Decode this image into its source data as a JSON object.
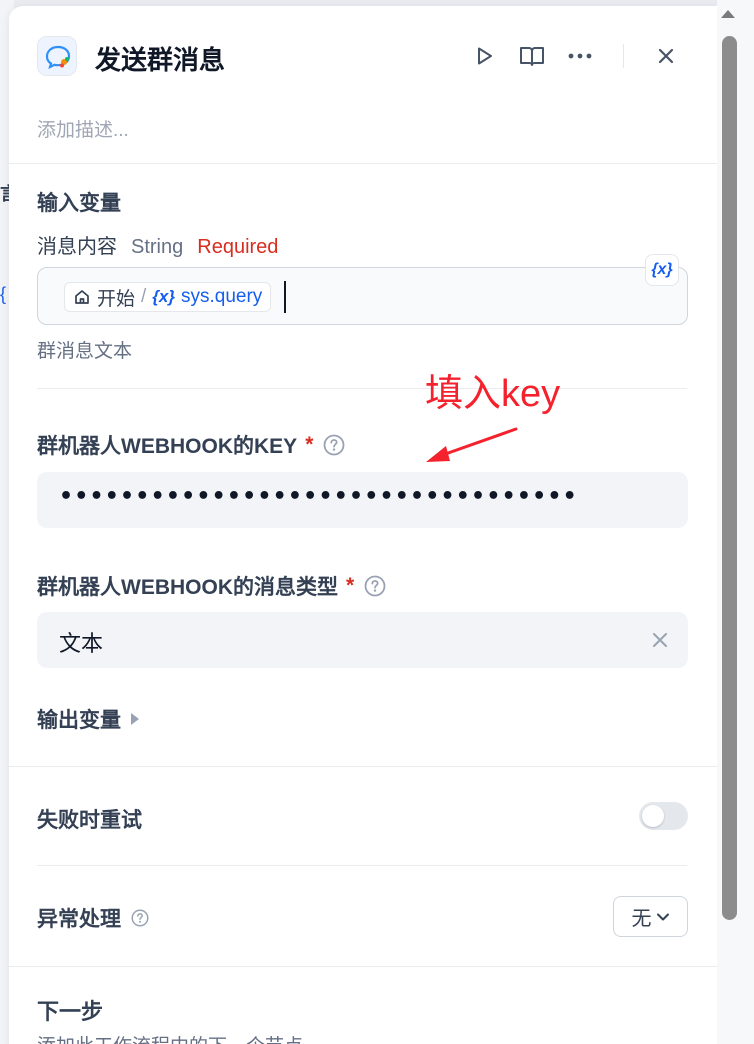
{
  "header": {
    "title": "发送群消息",
    "icon": "chat-bubble-icon",
    "actions": [
      "play-icon",
      "book-open-icon",
      "more-horizontal-icon",
      "close-icon"
    ]
  },
  "description_placeholder": "添加描述...",
  "input_section": {
    "title": "输入变量",
    "variable": {
      "name": "消息内容",
      "type": "String",
      "required_label": "Required",
      "chip_node": "开始",
      "chip_separator": "/",
      "chip_var": "sys.query",
      "var_button_label": "{x}",
      "hint": "群消息文本"
    }
  },
  "annotation": {
    "text": "填入key",
    "color": "#f5222d"
  },
  "webhook_key": {
    "label": "群机器人WEBHOOK的KEY",
    "required_mark": "*",
    "masked_value": "••••••••••••••••••••••••••••••••••"
  },
  "message_type": {
    "label": "群机器人WEBHOOK的消息类型",
    "required_mark": "*",
    "value": "文本"
  },
  "output_section": {
    "title": "输出变量"
  },
  "retry": {
    "label": "失败时重试",
    "enabled": false
  },
  "error_handling": {
    "label": "异常处理",
    "value": "无"
  },
  "next_step": {
    "title": "下一步",
    "desc": "添加此工作流程中的下一个节点"
  },
  "colors": {
    "accent": "#155eef",
    "required": "#d92d20",
    "annotation": "#f5222d"
  }
}
